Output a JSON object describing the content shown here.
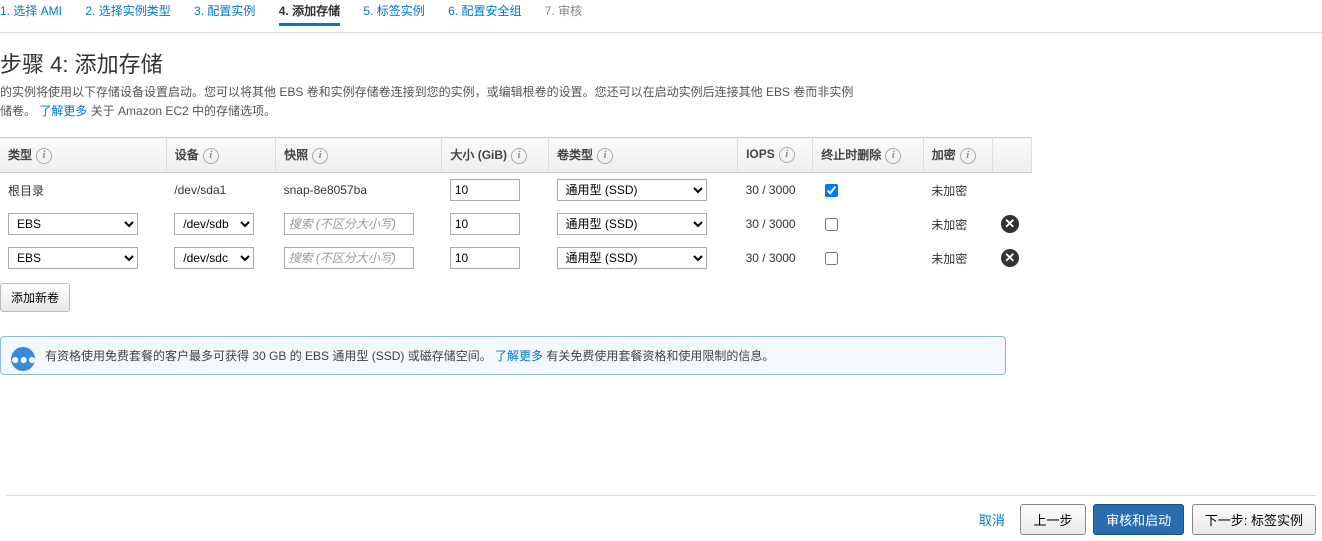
{
  "wizard": {
    "steps": [
      {
        "label": "1. 选择 AMI",
        "active": false
      },
      {
        "label": "2. 选择实例类型",
        "active": false
      },
      {
        "label": "3. 配置实例",
        "active": false
      },
      {
        "label": "4. 添加存储",
        "active": true
      },
      {
        "label": "5. 标签实例",
        "active": false
      },
      {
        "label": "6. 配置安全组",
        "active": false
      },
      {
        "label": "7. 审核",
        "active": false
      }
    ]
  },
  "page": {
    "title": "步骤 4: 添加存储",
    "desc_a": "的实例将使用以下存储设备设置启动。您可以将其他 EBS 卷和实例存储卷连接到您的实例，或编辑根卷的设置。您还可以在启动实例后连接其他 EBS 卷而非实例",
    "desc_b": "储卷。 ",
    "desc_link": "了解更多",
    "desc_c": " 关于 Amazon EC2 中的存储选项。"
  },
  "table": {
    "headers": {
      "type": "类型",
      "device": "设备",
      "snapshot": "快照",
      "size": "大小 (GiB)",
      "voltype": "卷类型",
      "iops": "IOPS",
      "del": "终止时删除",
      "enc": "加密"
    },
    "rows": [
      {
        "kind": "root",
        "type_label": "根目录",
        "device": "/dev/sda1",
        "snapshot": "snap-8e8057ba",
        "size": "10",
        "voltype": "通用型 (SSD)",
        "iops": "30 / 3000",
        "del": true,
        "enc": "未加密",
        "remove": false
      },
      {
        "kind": "ebs",
        "type_label": "EBS",
        "device": "/dev/sdb",
        "snapshot": "",
        "snapshot_ph": "搜索 (不区分大小写)",
        "size": "10",
        "voltype": "通用型 (SSD)",
        "iops": "30 / 3000",
        "del": false,
        "enc": "未加密",
        "remove": true
      },
      {
        "kind": "ebs",
        "type_label": "EBS",
        "device": "/dev/sdc",
        "snapshot": "",
        "snapshot_ph": "搜索 (不区分大小写)",
        "size": "10",
        "voltype": "通用型 (SSD)",
        "iops": "30 / 3000",
        "del": false,
        "enc": "未加密",
        "remove": true
      }
    ],
    "add_button": "添加新卷"
  },
  "note": {
    "text_a": "有资格使用免费套餐的客户最多可获得 30 GB 的 EBS 通用型 (SSD) 或磁存储空间。 ",
    "link": "了解更多",
    "text_b": " 有关免费使用套餐资格和使用限制的信息。"
  },
  "footer": {
    "cancel": "取消",
    "prev": "上一步",
    "review": "审核和启动",
    "next": "下一步: 标签实例"
  }
}
